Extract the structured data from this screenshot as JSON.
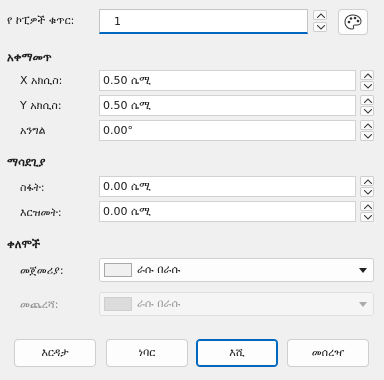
{
  "columns": {
    "label": "የ ኮፒዎች ቁጥር:",
    "value": "1",
    "color_button_icon": "palette-icon"
  },
  "placement": {
    "heading": "አቀማመጥ",
    "x_label": "X አክሲስ:",
    "x_value": "0.50 ሴሚ",
    "y_label": "Y አክሲስ:",
    "y_value": "0.50 ሴሚ",
    "angle_label": "አንግል",
    "angle_value": "0.00°"
  },
  "enlargement": {
    "heading": "ማሳደጊያ",
    "width_label": "ስፋት:",
    "width_value": "0.00 ሴሚ",
    "height_label": "እርዝመት:",
    "height_value": "0.00 ሴሚ"
  },
  "colors": {
    "heading": "ቀለሞች",
    "start_label": "መጀመሪያ:",
    "start_value": "ራሱ በራሱ",
    "end_label": "መጨረሻ:",
    "end_value": "ራሱ በራሱ"
  },
  "buttons": {
    "help": "እርዳታ",
    "reset": "ነባር",
    "ok": "እሺ",
    "cancel": "መሰረዣ"
  },
  "colors_hex": {
    "focus_accent": "#0067c0",
    "background": "#f0f0f0"
  }
}
